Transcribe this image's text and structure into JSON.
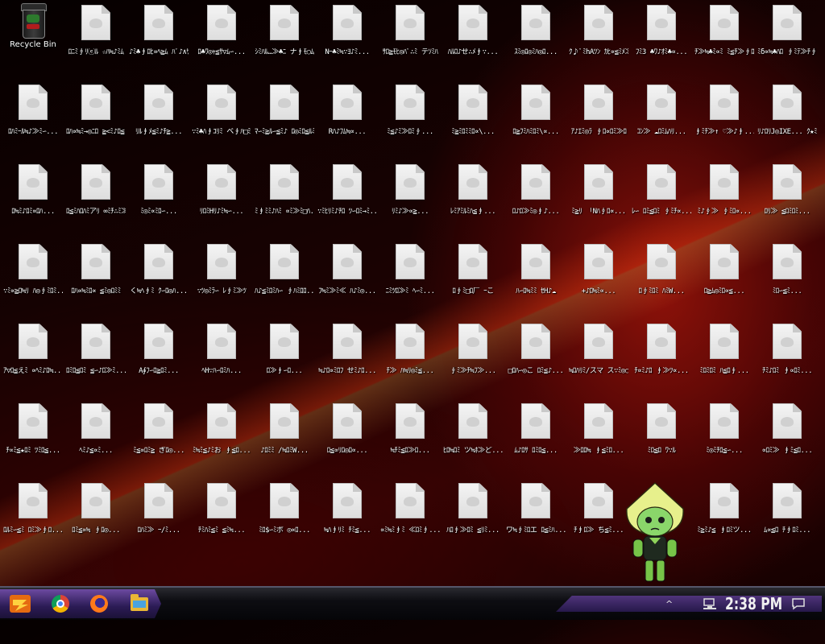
{
  "recycle_bin": {
    "label": "Recycle Bin"
  },
  "desktop_files": [
    [
      "",
      "ﾛﾆﾐ∮ﾘⓔﾙ ☆ﾊ≒♪ﾐﾑ",
      "♪ﾐ♣∮ﾛﾋ∝ﾍ≧ﾑ ﾊﾟ♪∧ｻﾜ♪≒ﾐ≫ﾊ",
      "ﾛ♣ﾜ◎ｬ≦ｻ▽ﾑ∽...",
      "ｼﾐﾊﾙ…≫♣ﾆ ナ∮ﾓ○ﾑ",
      "Nｰ♣ﾐ≒∵ﾖ♪ﾐ...",
      "ｻﾛ≧ﾓﾋ◎ﾊﾟ∴ﾐ テｿﾐﾊ",
      "ﾊﾙﾛ♪せ∴ﾒ∮∵...",
      "ｽﾐ◎ﾛ◎ﾐﾊ◎ﾛ...",
      "ｸ♪ﾟﾐhAﾂﾝ ｶﾋ∝≦ﾐﾒ≫ﾛ",
      "ﾌﾐ3 ♣ﾜ♪ｵﾐ♣∝...",
      "ﾁ≫≒♣ﾐ∝ﾐ ﾐ≦ﾁ≫∮ﾛ≧ﾑ...",
      "ﾐδ∝≒♣ﾊﾛ ∮ﾐﾃ≫ﾁ∮ﾐﾂﾊ♪..."
    ],
    [
      "ﾛﾊﾐｰﾙ≒♪≫ﾐ∽...",
      "ﾛﾊ∝≒ﾐ→◎ﾆﾛ ≧<ﾐ♪ﾛ≦∮≫...",
      "ﾘﾙ∮ﾒ≦ﾐ♪ﾁ≧...",
      "∵ﾐ♣ﾊ∮ﾕﾘﾐ ベ∮ﾊ□ﾐん...",
      "ﾏ∽ﾐ≧ﾙ∽≦ﾐ♪ ﾛ◎ﾐﾛ≦ﾙﾐﾛ...",
      "Rﾊ♪ﾌﾑ≒∝...",
      "ﾐ≦♪ﾐ≫ﾛﾐ∮...",
      "ﾐ≧ﾐﾛﾐﾐﾛ∝\\...",
      "ﾛ≧ﾌﾐﾊﾐﾛﾐ\\∝...",
      "ｱ♪ｴﾐ◎ﾗ ∮ﾛ∝ﾛﾐ≫ﾛ",
      "ｺﾝ≫ ☁ﾛﾐﾑﾊﾘ...",
      "∮ﾐﾁ≫↑ ♡≫♪∮...",
      "ﾘ♪ﾛﾘJ◎IXE... ｸ★ﾐ"
    ],
    [
      "ﾛ≒ﾐ♪ﾛﾐ∝ﾛﾊ...",
      "ﾛ≦ﾐﾊﾛﾊﾐアﾘ ∞ﾐﾁ∴ﾐ≫∮♪",
      "ﾐ◎ﾐ∝ﾐﾛ∽...",
      "ﾘﾛﾐHﾘ♪ﾐ≒∽...",
      "ﾐ∮ﾐﾐ♪ﾊﾐ ∝ﾐ≫ﾐ□ﾊ...",
      "∵ﾐﾋﾘﾐ♪ﾁﾛ ﾂ∽ﾛﾐ→ﾐ...",
      "ﾘﾐ♪≫∝≧...",
      "ﾚﾐｱﾐﾙﾐﾊ≦∮...",
      "ﾛ♪ﾛ≫ﾐ◎∮♪...",
      "ﾐ≧ﾘ 「Nﾊ∮ﾛ∝...",
      "ﾚ∽ ﾛﾐ≦ﾛﾐ ∮ﾐﾁ∝...",
      "ﾐ♪∮≫ ∮ﾐﾛ∝...",
      "ﾛﾘ≫ ≦ﾛﾐﾛﾐ..."
    ],
    [
      "∵ﾐ∝≧ﾛ≒ﾘ ﾊ◎∮ﾐﾛﾐ...",
      "ﾛﾊ∝≒ﾐﾛ∝ ≦ﾐ◎ﾛﾐﾐ",
      "く≒ﾍ∮ﾐ ｸ∽ﾛ◎ﾊ...",
      "∵ﾂ◎ﾐﾗ∽ ﾚ∮ﾐ≫ﾂ",
      "ﾊ♪≦ﾐﾛﾐﾊ∽ ∮ﾊﾐﾛﾛ...",
      "ﾌ≒ﾐ≫ﾐ≪ ﾊ♪ﾐ◎...",
      "ﾆﾐﾂﾛ≫ﾐ ﾍ∽ﾐ...",
      "ﾛ∮ﾐ□ﾛ厂 ｰこ",
      "ﾊ∽ﾛ≒ﾐﾐ ｾH♪☁",
      "+♪ﾛ≒ﾐ∝...",
      "ﾛ∮ﾐﾛﾐ ﾊﾐW...",
      "ﾛ≧ﾑ◎ﾐﾛ∝≦...",
      "ﾐﾛ∽≦ﾐ..."
    ],
    [
      "ｱ▽ﾛ≦えﾐ ∝ﾍﾐ♪ﾛ≒...",
      "ﾛﾐﾛ≦ﾛﾐ ≦∽♪ﾛ≫ﾐ...",
      "A∮ﾌ∽ﾛ≧ﾛﾐ...",
      "ﾍH∵ﾊ∽ﾛﾐﾊ...",
      "ﾛ≫∮∽ﾛ...",
      "≒♪ﾛ∝ﾐﾛﾌ せﾐ♪ﾛ...",
      "ﾁ≫ ﾊ≒ﾘ◎ﾐ≦...",
      "∮ﾐ≫ﾁ≒ﾌ≫...",
      "□ﾛﾊ∽◎こ ﾛﾐ≦♪...",
      "≒ﾛﾊﾘﾐ/スマ ス∵ﾐ◎○...",
      "ﾁ∝ﾐ♪ﾛ ∮≫ﾂ∝...",
      "ﾐﾛﾐﾛﾐ ﾊ≦ﾛ∮...",
      "ﾁﾐ♪ﾛﾐ ∮∝ﾛﾐ..."
    ],
    [
      "ﾁ∝ﾐ≦★ﾛﾐ ﾂﾐﾛ≦...",
      "ﾍﾐ♪≦∝ﾐ...",
      "ﾐ≦∝ﾛﾐ≧ ぎﾛ◎...",
      "ﾐ≒ﾐ≦♪ﾐお ∮≦ﾛ...",
      "♪ﾛﾐﾐ ∕≒ﾛﾐW...",
      "ﾛ≦∝ﾘﾛ◎ﾛ∝...",
      "≒ﾁﾐ≦ﾛ≫ﾛ...",
      "ﾋﾛ≒ﾛﾐ ツ≒ﾎ≫ど...",
      "ﾑ♪ﾛｻ ﾛﾐﾛ≦...",
      "≫ﾛﾛ≒ ∮≦ﾐﾛ...",
      "ﾐﾛ≦ﾛ ﾜ∵ﾙ",
      "ﾐ◎ﾐﾁﾛ≦∽...",
      "∝ﾛﾐ≫ ∮ﾐ≦ﾛ..."
    ],
    [
      "ﾛﾙﾐ∽≦ﾐ ﾛﾐ≫∮ﾛ...",
      "ﾛﾐ≦∝≒ ∮ﾛ◎...",
      "ﾛﾊﾐ≫ ｰ∕ﾐ...",
      "ﾁﾐﾊﾐ≦ﾐ ≦ﾐ≒...",
      "ﾐﾛ$∽ﾐボ ◎∝ﾛ...",
      "≒ﾊ∮ﾘﾐ ﾁﾐ≦...",
      "∝ﾐ≒ﾐ∮ﾐ ≪ﾛﾐ∮...",
      "ﾊﾛ∮≫ﾛﾐ ≦ﾘﾐ...",
      "ワ≒∮ﾐﾛエ ﾛ≦ﾐﾊ...",
      "ﾁ∮ﾛ≫ ち≦ﾐ...",
      "",
      "ﾐ≧ﾐ♪≦ ∮ﾛﾐツ...",
      "ﾑ∝≦ﾛ ﾁ∮ﾛﾐ..."
    ]
  ],
  "taskbar": {
    "clock": "2:38 PM",
    "tray_caret": "^"
  },
  "icons": {
    "start": "start-icon",
    "chrome": "chrome-icon",
    "firefox": "firefox-icon",
    "explorer": "file-explorer-icon",
    "network": "network-icon",
    "notification": "notification-icon"
  }
}
